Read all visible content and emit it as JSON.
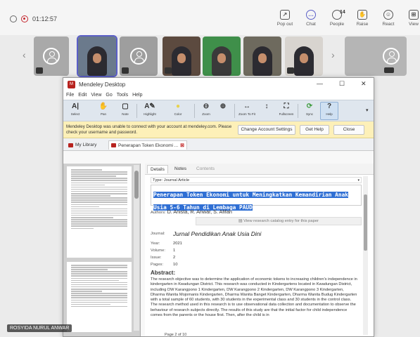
{
  "teams": {
    "timer": "01:12:57",
    "buttons": [
      {
        "label": "Pop out",
        "icon": "pop-out-icon"
      },
      {
        "label": "Chat",
        "icon": "chat-icon"
      },
      {
        "label": "People",
        "icon": "people-icon",
        "count": "14"
      },
      {
        "label": "Raise",
        "icon": "raise-hand-icon"
      },
      {
        "label": "React",
        "icon": "react-icon"
      },
      {
        "label": "View",
        "icon": "view-icon"
      }
    ],
    "presenter_name": "ROSYIDA NURUL ANWAR"
  },
  "mendeley": {
    "window_title": "Mendeley Desktop",
    "menu": [
      "File",
      "Edit",
      "View",
      "Go",
      "Tools",
      "Help"
    ],
    "toolbar": [
      {
        "label": "Select",
        "icon": "cursor-icon"
      },
      {
        "label": "Pan",
        "icon": "hand-icon"
      },
      {
        "label": "Note",
        "icon": "note-icon"
      },
      {
        "label": "Highlight",
        "icon": "highlight-icon"
      },
      {
        "label": "Color",
        "icon": "color-icon"
      },
      {
        "label": "Zoom",
        "icon": "zoom-out-icon"
      },
      {
        "label": "",
        "icon": "zoom-in-icon"
      },
      {
        "label": "Zoom To Fit",
        "icon": "zoom-fit-icon"
      },
      {
        "label": "",
        "icon": "fit-height-icon"
      },
      {
        "label": "Fullscreen",
        "icon": "fullscreen-icon"
      },
      {
        "label": "Sync",
        "icon": "sync-icon"
      },
      {
        "label": "Help",
        "icon": "help-icon"
      }
    ],
    "warning": {
      "message": "Mendeley Desktop was unable to connect with your account at mendeley.com. Please check your username and password.",
      "change_settings": "Change Account Settings",
      "get_help": "Get Help",
      "close": "Close"
    },
    "tabs": {
      "library": "My Library",
      "document": "Penerapan Token Ekonomi ..."
    },
    "details_tabs": [
      "Details",
      "Notes",
      "Contents"
    ],
    "document": {
      "type_label": "Type: Journal Article",
      "title": "Penerapan Token Ekonomi untuk Meningkatkan Kemandirian Anak Usia 5-6 Tahun di Lembaga PAUD",
      "authors_label": "Authors:",
      "authors": "D. Anista, R. Anwar, S. Afifah",
      "catalog_link": "View research catalog entry for this paper",
      "journal_label": "Journal:",
      "journal": "Jurnal Pendidikan Anak Usia Dini",
      "year_label": "Year:",
      "year": "2021",
      "volume_label": "Volume:",
      "volume": "1",
      "issue_label": "Issue:",
      "issue": "2",
      "pages_label": "Pages:",
      "pages": "10",
      "abstract_label": "Abstract:",
      "abstract": "The research objective was to determine the application of economic tokens to increasing children's independence in kindergarten in Kwadungan District. This research was conducted in Kindergartens located in Kwadungan District, including DW Karangpono 1 Kindergarten, DW Karangpono 2 Kindergarten, DW Karangpono 3 Kindergarten, Dharma Wanita Mojomanis Kindergarten, Dharma Wanita Banget Kindergarten, Dharma Wanita Budug Kindergarten with a total sample of 60 students, with 30 students in the experimental class and 30 students in the control class. The research method used in this research is to use observational data collection and documentation to observe the behaviour of research subjects directly. The results of this study are that the initial factor for child independence comes from the parents or the house first. Then, after the child is in"
    },
    "page_indicator": "Page 2 of 10"
  }
}
